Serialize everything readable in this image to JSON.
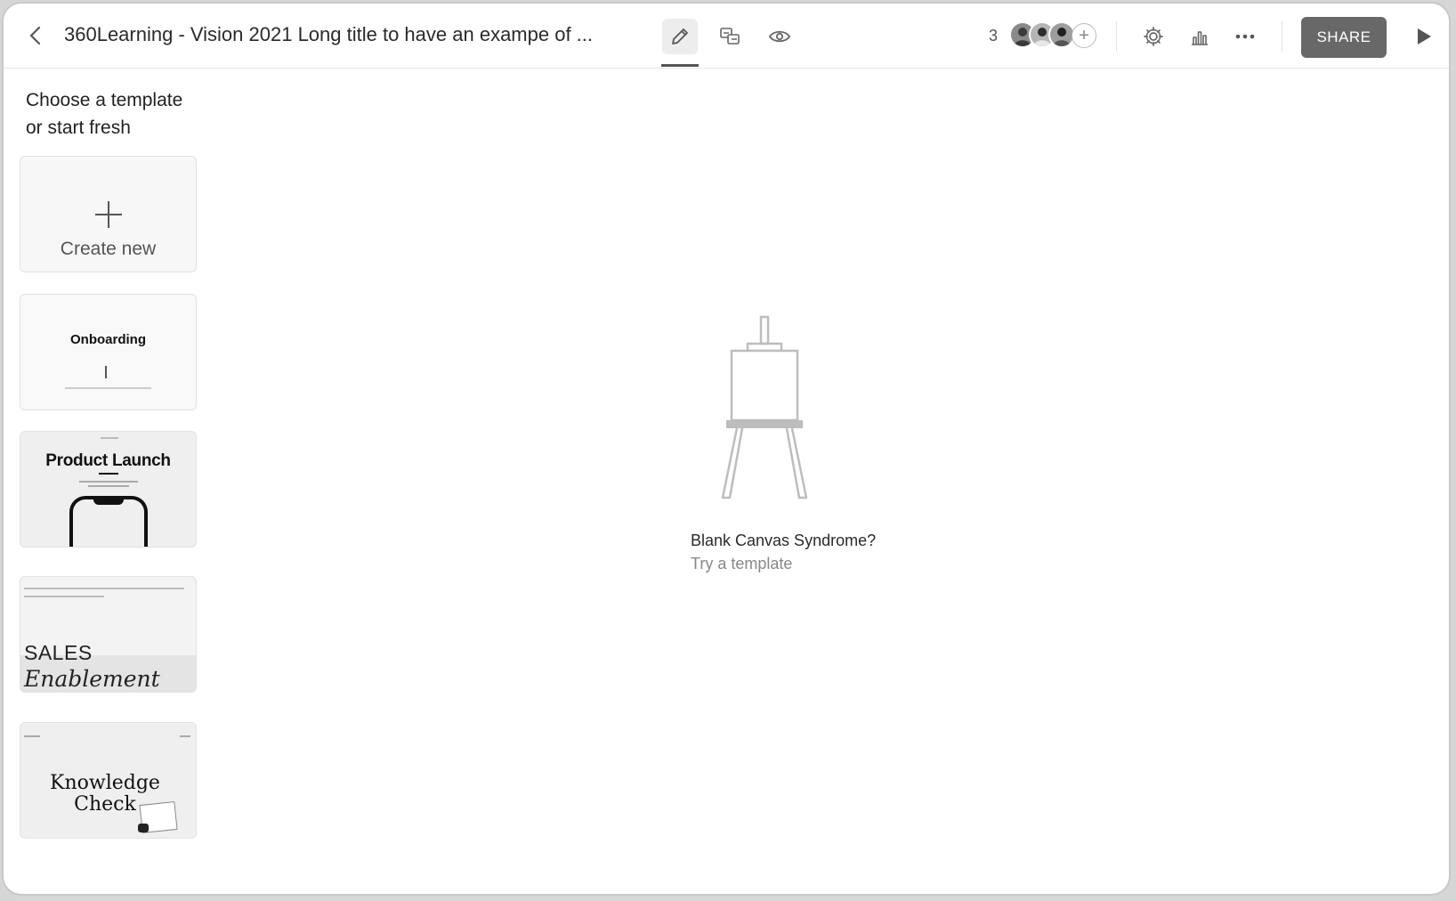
{
  "header": {
    "title": "360Learning - Vision 2021 Long title to have an exampe of ...",
    "collaborator_count": "3",
    "share_label": "SHARE",
    "icons": [
      "back-arrow-icon",
      "pencil-icon",
      "translate-icon",
      "eye-icon",
      "plus-icon",
      "gear-icon",
      "bar-chart-icon",
      "more-dots-icon",
      "play-icon"
    ]
  },
  "sidebar": {
    "heading_line1": "Choose a template",
    "heading_line2": "or start fresh",
    "create_new_label": "Create new",
    "templates": {
      "onboarding": "Onboarding",
      "product_launch": "Product Launch",
      "sales_1": "SALES",
      "sales_2": "Enablement",
      "knowledge_1": "Knowledge",
      "knowledge_2": "Check"
    }
  },
  "main": {
    "empty_title": "Blank Canvas Syndrome?",
    "empty_sub": "Try a  template"
  },
  "colors": {
    "share_bg": "#686868",
    "active_tab_bg": "#ededed",
    "border": "#e2e2e2"
  }
}
